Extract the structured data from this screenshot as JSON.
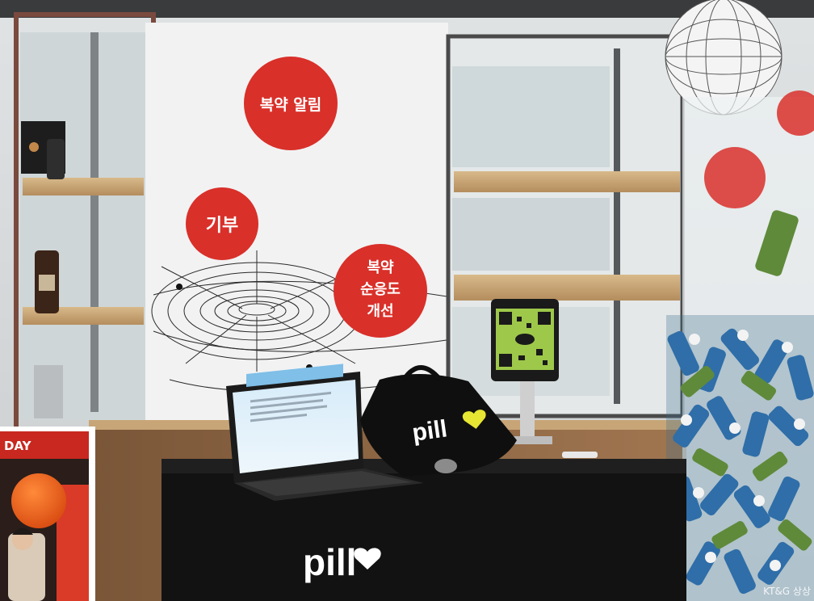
{
  "scene": {
    "bubbles": [
      {
        "lines": [
          "복약 알림"
        ]
      },
      {
        "lines": [
          "기부"
        ]
      },
      {
        "lines": [
          "복약",
          "순응도",
          "개선"
        ]
      }
    ],
    "brand": {
      "bag_logo": "pill",
      "counter_logo": "pill"
    },
    "inset_banner": "DAY",
    "corner_mark": "KT&G 상상"
  },
  "colors": {
    "accent_red": "#d9302a",
    "logo_yellow": "#e6e633",
    "counter_black": "#121212"
  }
}
